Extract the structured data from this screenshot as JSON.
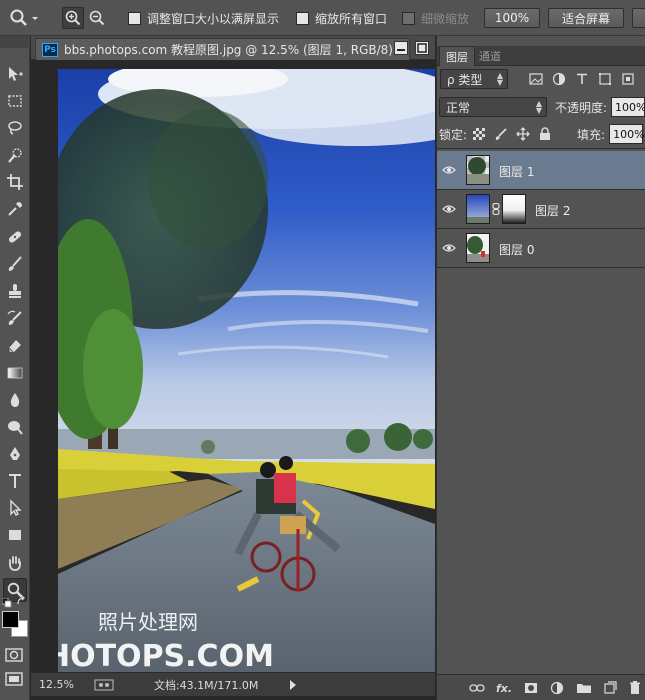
{
  "options_bar": {
    "resize_windows_label": "调整窗口大小以满屏显示",
    "zoom_all_windows_label": "缩放所有窗口",
    "scrubby_zoom_label": "细微缩放",
    "actual_pixels_label": "100%",
    "fit_screen_label": "适合屏幕"
  },
  "document": {
    "title": "bbs.photops.com 教程原图.jpg @ 12.5% (图层 1, RGB/8) *",
    "app_badge": "Ps",
    "watermark_cn": "照片处理网",
    "watermark_url": "PHOTOPS.COM"
  },
  "status_bar": {
    "zoom": "12.5%",
    "doc_size": "文档:43.1M/171.0M"
  },
  "layers_panel": {
    "tabs": [
      {
        "label": "图层",
        "active": true
      },
      {
        "label": "通道",
        "active": false
      }
    ],
    "filter_label": "ρ 类型",
    "blend_mode": "正常",
    "opacity_label": "不透明度:",
    "opacity_value": "100%",
    "lock_label": "锁定:",
    "fill_label": "填充:",
    "fill_value": "100%",
    "layers": [
      {
        "name": "图层 1",
        "selected": true,
        "has_mask": false
      },
      {
        "name": "图层 2",
        "selected": false,
        "has_mask": true
      },
      {
        "name": "图层 0",
        "selected": false,
        "has_mask": false
      }
    ],
    "footer_icons": [
      "link-icon",
      "fx-icon",
      "add-mask-icon",
      "adjustment-icon",
      "group-folder-icon",
      "new-layer-icon",
      "trash-icon"
    ]
  },
  "colors": {
    "ui_panel": "#535353",
    "canvas_bg": "#282828",
    "selected_layer": "#6b7b8f",
    "ps_blue": "#31a8ff"
  }
}
